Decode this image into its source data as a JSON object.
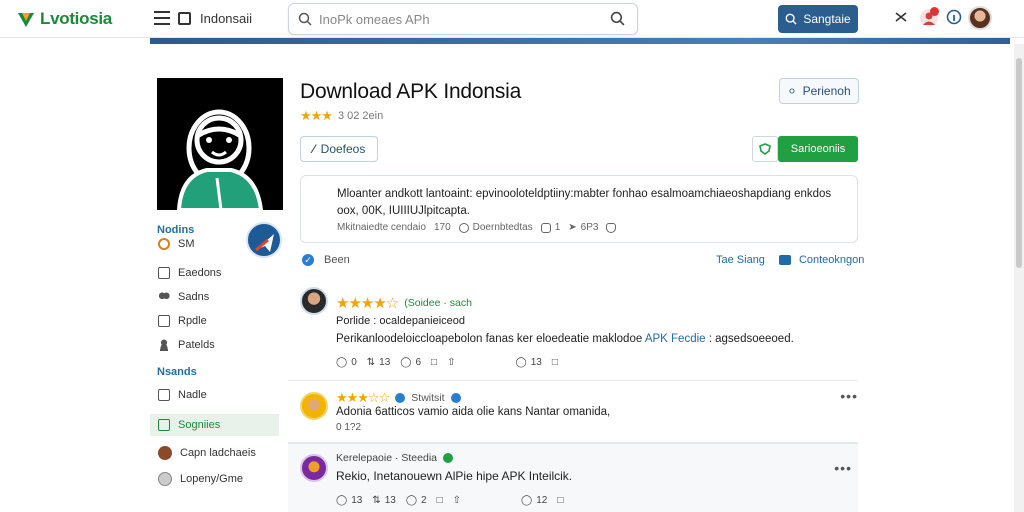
{
  "header": {
    "logo_text": "Lvotiosia",
    "site_name": "Indonsaii",
    "search_placeholder": "InoPk omeaes APh",
    "signin_label": "Sangtaie",
    "notification_count": "2"
  },
  "sidebar": {
    "section1_title": "Nodins",
    "section1_sub": "SM",
    "items": [
      {
        "label": "Eaedons"
      },
      {
        "label": "Sadns"
      },
      {
        "label": "Rpdle"
      },
      {
        "label": "Patelds"
      }
    ],
    "section2_title": "Nsands",
    "items2": [
      {
        "label": "Nadle"
      },
      {
        "label": "Sogniies"
      },
      {
        "label": "Capn ladchaeis"
      },
      {
        "label": "Lopeny/Gme"
      }
    ]
  },
  "app": {
    "title": "Download APK Indonsia",
    "rating_text": "3 02 2ein",
    "report_label": "Perienoh",
    "docs_label": "Doefeos",
    "install_label": "Sarioeoniis",
    "description": "Mloanter andkott lantoaint: epvinooloteldptiiny:mabter fonhao esalmoamchiaeoshapdiang enkdos oox, 00K, IUIIIUJlpitcapta.",
    "meta_text": "Mkitnaiedte cendaio",
    "meta_count": "170",
    "meta_label2": "Doernbtedtas",
    "meta_num1": "1",
    "meta_num2": "6P3"
  },
  "verified": {
    "label": "Been",
    "link1": "Tae Siang",
    "link2": "Conteokngon"
  },
  "reviews": [
    {
      "rating_label": "(Soidee · sach",
      "subline": "Porlide : ocaldepanieiceod",
      "body": "Perikanloodeloiccloapebolon fanas ker eloedeatie maklodoe",
      "body_link": "APK Fecdie",
      "body_tail": ": agsedsoeeoed.",
      "likes": "0",
      "reposts": "13",
      "comments": "6",
      "views": "13"
    },
    {
      "rating_label": "Stwitsit",
      "body": "Adonia 6atticos vamio aida olie kans Nantar omanida,",
      "subline": "0 1?2"
    },
    {
      "rating_label": "Kerelepaoie · Steedia",
      "body": "Rekio, Inetanouewn AlPie hipe APK Inteilcik.",
      "likes": "13",
      "reposts": "13",
      "comments": "2",
      "views": "12"
    }
  ],
  "colors": {
    "brand_green": "#1a8a3a",
    "accent_blue": "#2b5d8e",
    "star": "#f0a500"
  }
}
